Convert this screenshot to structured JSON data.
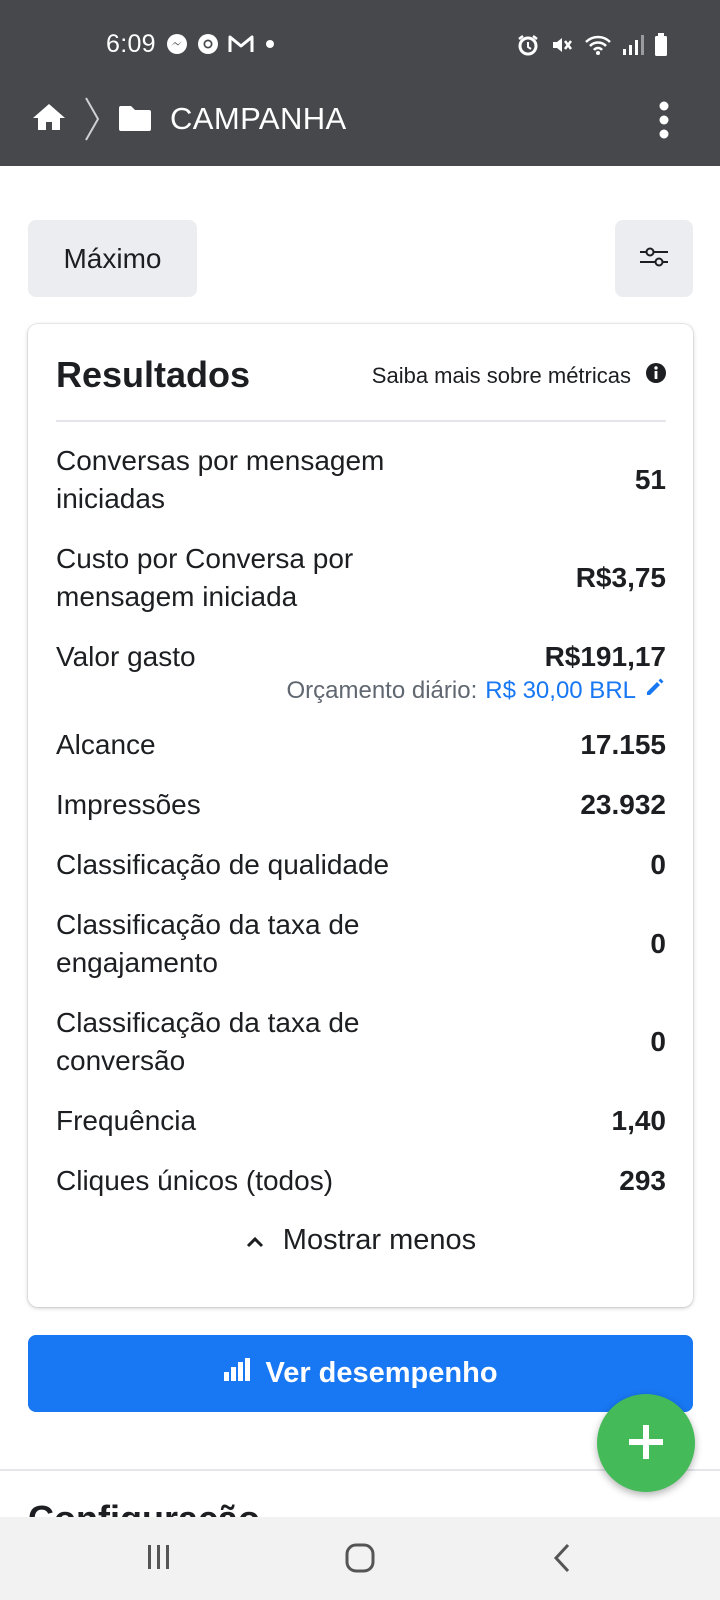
{
  "status_bar": {
    "time": "6:09",
    "left_icons": [
      "messenger-icon",
      "chrome-icon",
      "gmail-icon",
      "dot-icon"
    ],
    "right_icons": [
      "alarm-icon",
      "mute-icon",
      "wifi-icon",
      "signal-icon",
      "battery-icon"
    ]
  },
  "header": {
    "title": "CAMPANHA",
    "background": "#46484c"
  },
  "toolbar": {
    "mode_label": "Máximo"
  },
  "results": {
    "title": "Resultados",
    "help_link": "Saiba mais sobre métricas",
    "metrics": [
      {
        "label": "Conversas por mensagem iniciadas",
        "value": "51"
      },
      {
        "label": "Custo por Conversa por mensagem iniciada",
        "value": "R$3,75"
      },
      {
        "label": "Valor gasto",
        "value": "R$191,17",
        "budget_label": "Orçamento diário:",
        "budget_value": "R$ 30,00 BRL"
      },
      {
        "label": "Alcance",
        "value": "17.155"
      },
      {
        "label": "Impressões",
        "value": "23.932"
      },
      {
        "label": "Classificação de qualidade",
        "value": "0"
      },
      {
        "label": "Classificação da taxa de engajamento",
        "value": "0"
      },
      {
        "label": "Classificação da taxa de conversão",
        "value": "0"
      },
      {
        "label": "Frequência",
        "value": "1,40"
      },
      {
        "label": "Cliques únicos (todos)",
        "value": "293"
      }
    ],
    "toggle_label": "Mostrar menos"
  },
  "performance_button": {
    "label": "Ver desempenho",
    "color": "#1877f2"
  },
  "next_section": {
    "title": "Configuração"
  },
  "fab": {
    "icon": "plus-icon",
    "color": "#44bb58"
  },
  "system_nav": [
    "recents-icon",
    "home-icon",
    "back-icon"
  ]
}
